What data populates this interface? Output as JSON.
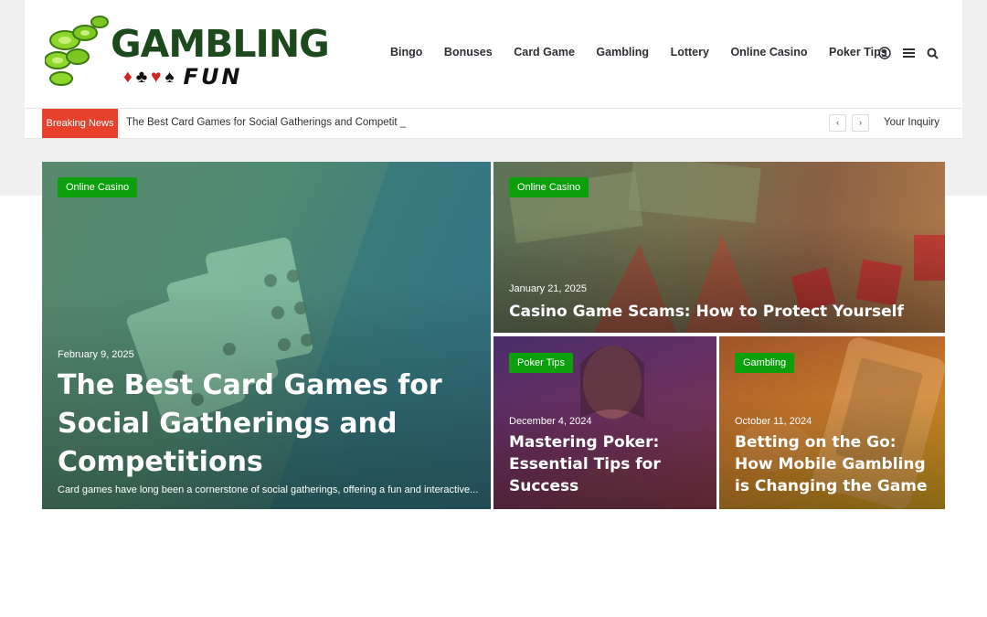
{
  "brand": {
    "name": "GAMBLING",
    "sub": "FUN",
    "suits": [
      "♦",
      "♣",
      "♥",
      "♠"
    ],
    "colors": {
      "primary": "#1c4a1c",
      "chip": "#7ed321",
      "accent_red": "#e8412b",
      "badge_green": "#0ca00c"
    }
  },
  "nav": {
    "items": [
      "Bingo",
      "Bonuses",
      "Card Game",
      "Gambling",
      "Lottery",
      "Online Casino",
      "Poker Tips"
    ],
    "icons": [
      "user-icon",
      "menu-icon",
      "search-icon"
    ]
  },
  "ticker": {
    "label": "Breaking News",
    "text": "The Best Card Games for Social Gatherings and Competit _",
    "prev_icon": "chevron-left-icon",
    "next_icon": "chevron-right-icon",
    "inquiry": "Your Inquiry"
  },
  "featured": [
    {
      "category": "Online Casino",
      "date": "February 9, 2025",
      "title": "The Best Card Games for Social Gatherings and Competitions",
      "excerpt": "Card games have long been a cornerstone of social gatherings, offering a fun and interactive..."
    },
    {
      "category": "Online Casino",
      "date": "January 21, 2025",
      "title": "Casino Game Scams: How to Protect Yourself"
    },
    {
      "category": "Poker Tips",
      "date": "December 4, 2024",
      "title": "Mastering Poker: Essential Tips for Success"
    },
    {
      "category": "Gambling",
      "date": "October 11, 2024",
      "title": "Betting on the Go: How Mobile Gambling is Changing the Game"
    }
  ]
}
